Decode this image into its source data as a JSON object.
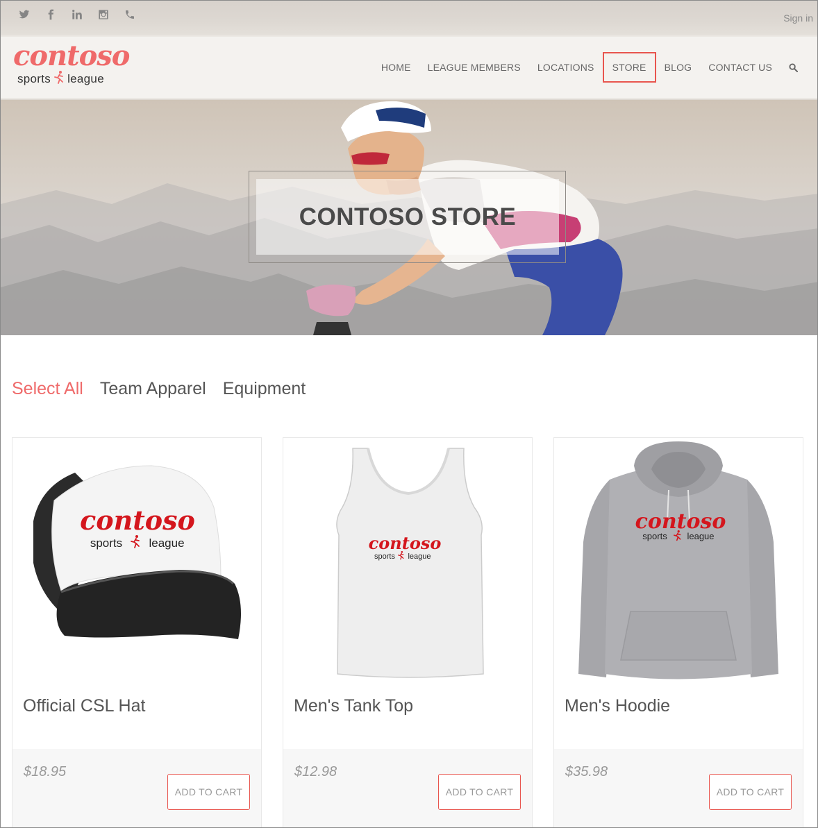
{
  "header": {
    "social_icons": [
      "twitter-icon",
      "facebook-icon",
      "linkedin-icon",
      "instagram-icon",
      "phone-icon"
    ],
    "sign_in": "Sign in"
  },
  "logo": {
    "word": "contoso",
    "sub_left": "sports",
    "sub_right": "league"
  },
  "nav": {
    "items": [
      "HOME",
      "LEAGUE MEMBERS",
      "LOCATIONS",
      "STORE",
      "BLOG",
      "CONTACT US"
    ],
    "active": "STORE",
    "search_icon": "search-icon"
  },
  "hero": {
    "title": "CONTOSO STORE"
  },
  "filters": {
    "items": [
      "Select All",
      "Team Apparel",
      "Equipment"
    ],
    "selected": "Select All"
  },
  "products": [
    {
      "name": "Official CSL Hat",
      "price": "$18.95",
      "button": "ADD TO CART",
      "print_word": "contoso",
      "print_sub_left": "sports",
      "print_sub_right": "league"
    },
    {
      "name": "Men's Tank Top",
      "price": "$12.98",
      "button": "ADD TO CART",
      "print_word": "contoso",
      "print_sub_left": "sports",
      "print_sub_right": "league"
    },
    {
      "name": "Men's Hoodie",
      "price": "$35.98",
      "button": "ADD TO CART",
      "print_word": "contoso",
      "print_sub_left": "sports",
      "print_sub_right": "league"
    }
  ],
  "colors": {
    "accent": "#ef6a6a",
    "highlight_border": "#e8554e",
    "brand_red": "#d4161d"
  }
}
